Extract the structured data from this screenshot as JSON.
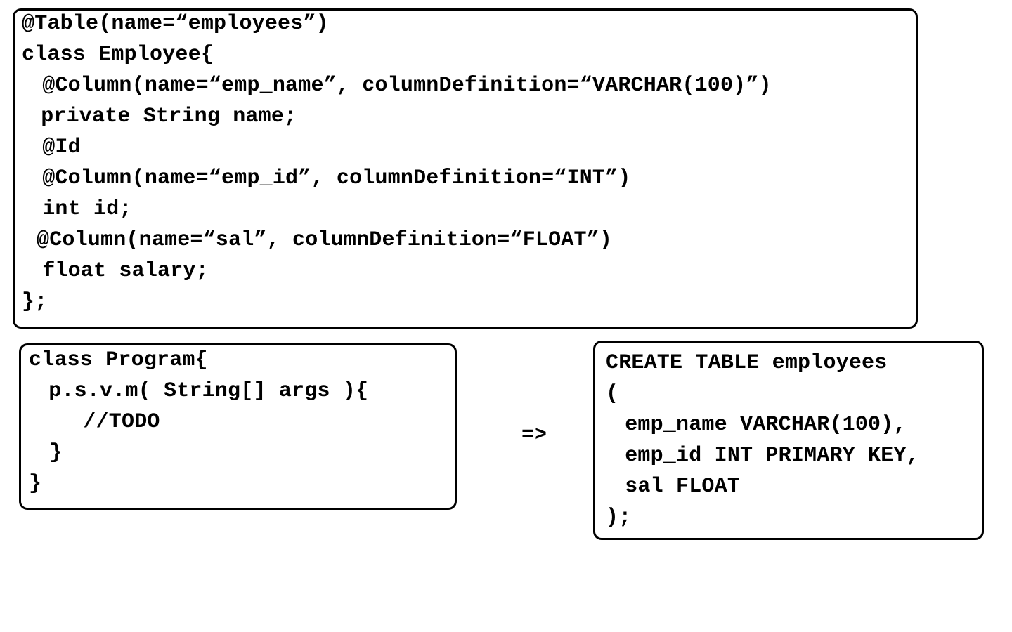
{
  "entity_class": {
    "lines": [
      "@Table(name=“employees”)",
      "class Employee{",
      " @Column(name=“emp_name”, columnDefinition=“VARCHAR(100)”)",
      " private String name;",
      " @Id",
      " @Column(name=“emp_id”, columnDefinition=“INT”)",
      " int id;",
      "@Column(name=“sal”, columnDefinition=“FLOAT”)",
      " float salary;",
      "};"
    ]
  },
  "program_class": {
    "lines": [
      "class Program{",
      " p.s.v.m( String[] args ){",
      "  //TODO",
      " }",
      "}"
    ]
  },
  "arrow": "=>",
  "sql_statement": {
    "lines": [
      "CREATE TABLE employees",
      "(",
      " emp_name VARCHAR(100),",
      " emp_id INT PRIMARY KEY,",
      " sal FLOAT",
      ");"
    ]
  }
}
